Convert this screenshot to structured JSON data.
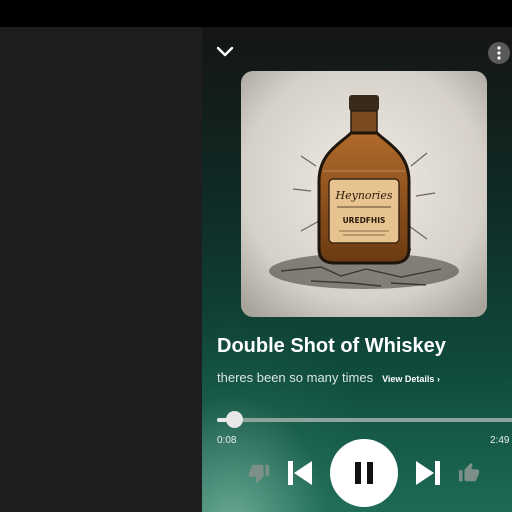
{
  "track": {
    "title": "Double Shot of Whiskey",
    "subtitle": "theres been so many times",
    "view_details": "View Details ›",
    "label_line_1": "Heynories",
    "label_line_2": "UREDFHIS",
    "progress_fraction": 0.08
  },
  "time": {
    "current": "0:08",
    "total": "2:49"
  },
  "icons": {
    "collapse": "chevron-down-icon",
    "more": "more-vertical-icon",
    "dislike": "thumbs-down-icon",
    "previous": "skip-previous-icon",
    "pause": "pause-icon",
    "next": "skip-next-icon",
    "like": "thumbs-up-icon"
  },
  "colors": {
    "accent": "#1d6a56",
    "progress": "#e8e8e8"
  }
}
